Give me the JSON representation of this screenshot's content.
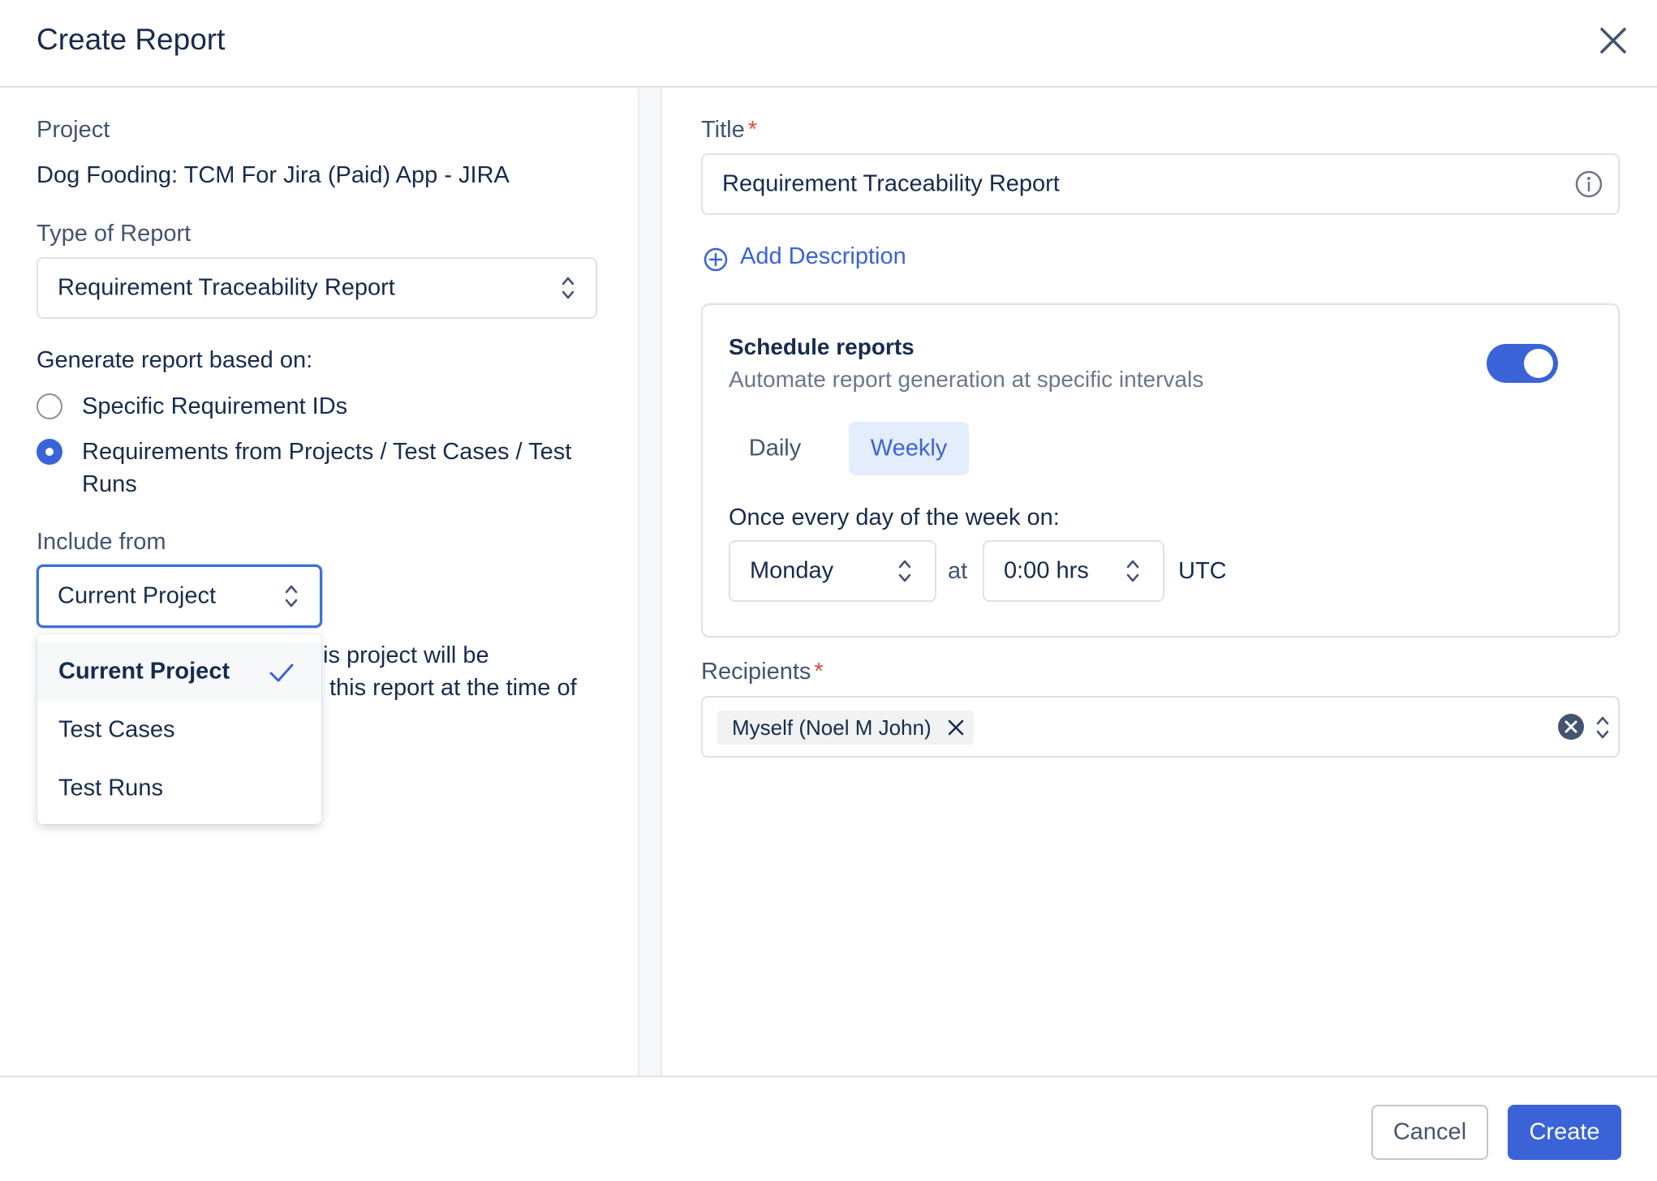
{
  "dialog": {
    "title": "Create Report",
    "close_icon": "close-icon"
  },
  "left": {
    "project_label": "Project",
    "project_value": "Dog Fooding: TCM For Jira (Paid) App - JIRA",
    "type_label": "Type of Report",
    "type_value": "Requirement Traceability Report",
    "generate_label": "Generate report based on:",
    "radio_options": [
      {
        "label": "Specific Requirement IDs",
        "checked": false
      },
      {
        "label_line1": "Requirements from Projects / Test Cases / Test",
        "label_line2": "Runs",
        "checked": true
      }
    ],
    "include_label": "Include from",
    "include_value": "Current Project",
    "dropdown_options": [
      {
        "label": "Current Project",
        "selected": true
      },
      {
        "label": "Test Cases",
        "selected": false
      },
      {
        "label": "Test Runs",
        "selected": false
      }
    ],
    "hidden_text_line1": "is project will be",
    "hidden_text_line2": "this report at the time of"
  },
  "right": {
    "title_label": "Title",
    "required_mark": "*",
    "title_value": "Requirement Traceability Report",
    "title_info_icon": "info-icon",
    "add_description": "Add Description",
    "schedule": {
      "title": "Schedule reports",
      "subtitle": "Automate report generation at specific intervals",
      "enabled": true,
      "frequency_options": [
        "Daily",
        "Weekly"
      ],
      "selected_frequency": "Weekly",
      "once_label": "Once every day of the week on:",
      "day_value": "Monday",
      "at_label": "at",
      "time_value": "0:00 hrs",
      "timezone": "UTC"
    },
    "recipients_label": "Recipients",
    "recipients": [
      "Myself (Noel M John)"
    ]
  },
  "footer": {
    "cancel": "Cancel",
    "create": "Create"
  },
  "colors": {
    "accent": "#3a63d8",
    "required": "#e2483d",
    "selected_segment_bg": "#e4edfc"
  }
}
